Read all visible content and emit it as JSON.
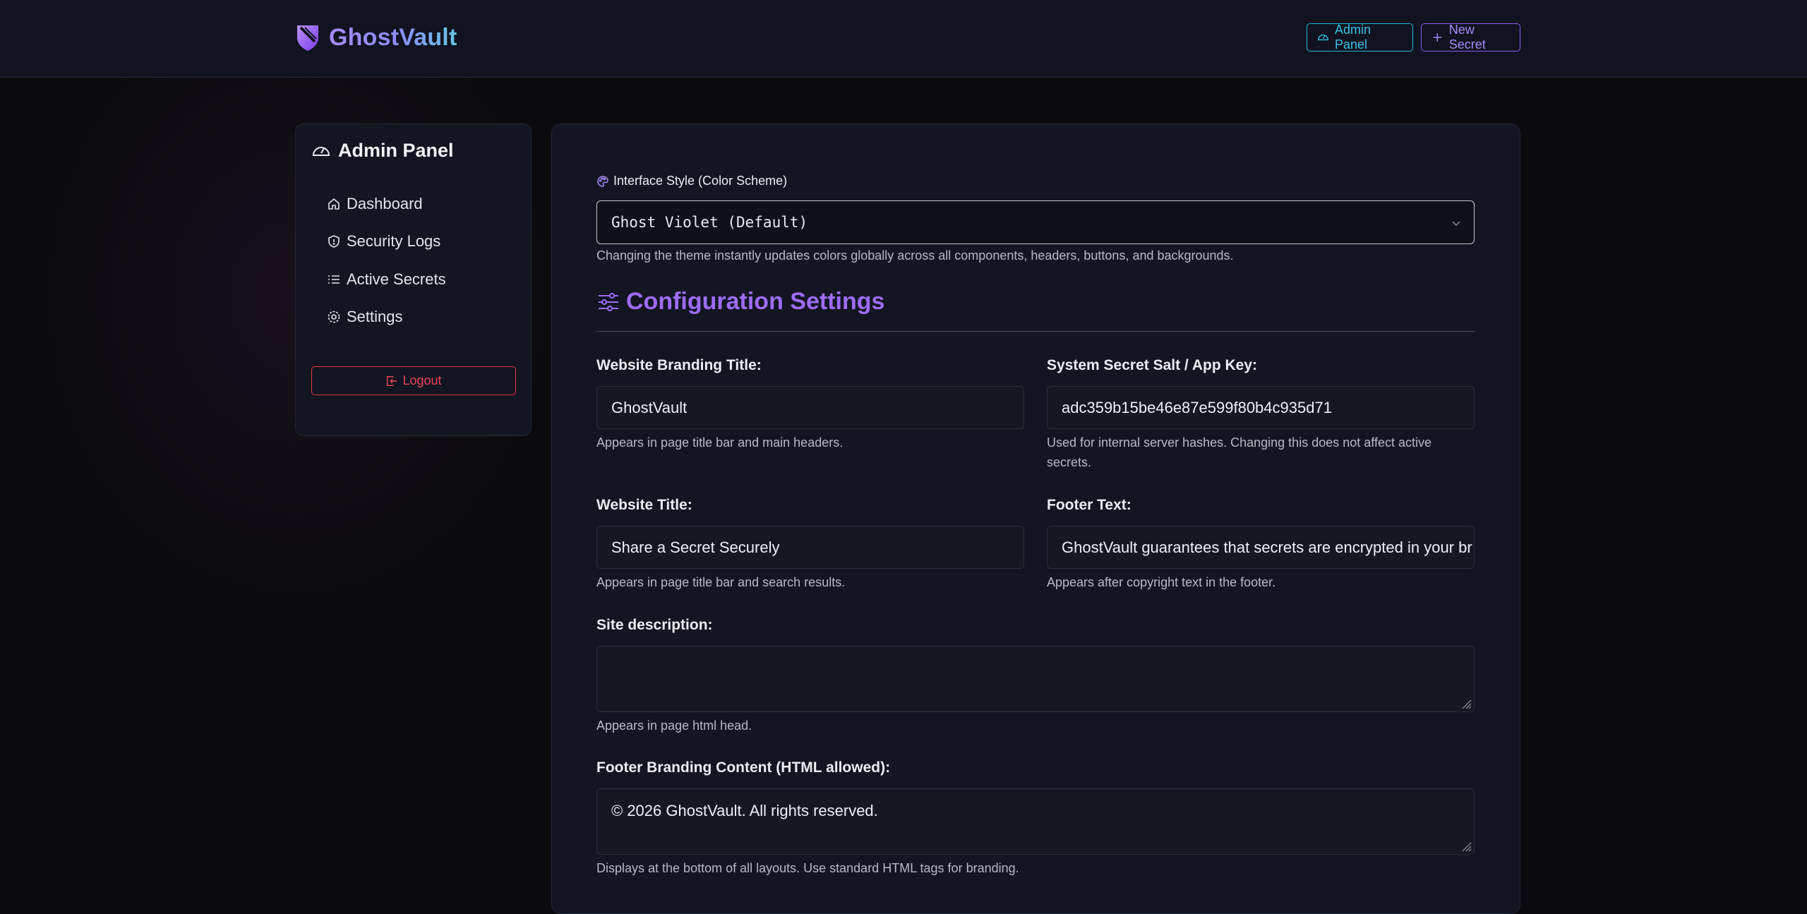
{
  "header": {
    "brand_name": "GhostVault",
    "admin_button": "Admin Panel",
    "new_secret_button": "New Secret"
  },
  "sidebar": {
    "title": "Admin Panel",
    "items": [
      {
        "label": "Dashboard",
        "icon": "home-icon"
      },
      {
        "label": "Security Logs",
        "icon": "shield-icon"
      },
      {
        "label": "Active Secrets",
        "icon": "list-icon"
      },
      {
        "label": "Settings",
        "icon": "gear-icon"
      }
    ],
    "logout_label": "Logout"
  },
  "theme": {
    "label": "Interface Style (Color Scheme)",
    "selected": "Ghost Violet (Default)",
    "help": "Changing the theme instantly updates colors globally across all components, headers, buttons, and backgrounds."
  },
  "config": {
    "title": "Configuration Settings",
    "fields": {
      "branding_title": {
        "label": "Website Branding Title:",
        "value": "GhostVault",
        "help": "Appears in page title bar and main headers."
      },
      "app_key": {
        "label": "System Secret Salt / App Key:",
        "value": "adc359b15be46e87e599f80b4c935d71",
        "help": "Used for internal server hashes. Changing this does not affect active secrets."
      },
      "website_title": {
        "label": "Website Title:",
        "value": "Share a Secret Securely",
        "help": "Appears in page title bar and search results."
      },
      "footer_text": {
        "label": "Footer Text:",
        "value": "GhostVault guarantees that secrets are encrypted in your br",
        "help": "Appears after copyright text in the footer."
      },
      "site_description": {
        "label": "Site description:",
        "value": "",
        "help": "Appears in page html head."
      },
      "footer_branding": {
        "label": "Footer Branding Content (HTML allowed):",
        "value": "© 2026 GhostVault. All rights reserved.",
        "help": "Displays at the bottom of all layouts. Use standard HTML tags for branding."
      }
    }
  },
  "colors": {
    "accent_violet": "#9d6cf7",
    "accent_cyan": "#34c3e3",
    "danger": "#ef4459",
    "panel_bg": "#131522"
  }
}
